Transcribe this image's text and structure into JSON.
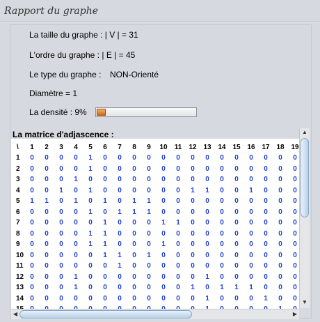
{
  "window": {
    "title": "Rapport du graphe"
  },
  "report": {
    "size_label": "La taille du graphe : | V | = 31",
    "order_label": "L'ordre du graphe : | E | = 45",
    "type_label": "Le type du graphe :",
    "type_value": "NON-Orienté",
    "diameter_label": "Diamètre = 1",
    "density_label": "La densité : 9%",
    "density_fraction": 0.09
  },
  "matrix": {
    "title": "La matrice d'adjascence :",
    "corner": "\\",
    "columns": [
      "1",
      "2",
      "3",
      "4",
      "5",
      "6",
      "7",
      "8",
      "9",
      "10",
      "11",
      "12",
      "13",
      "14",
      "15",
      "16",
      "17",
      "18",
      "19"
    ],
    "rows": [
      {
        "label": "1",
        "values": [
          "0",
          "0",
          "0",
          "0",
          "1",
          "0",
          "0",
          "0",
          "0",
          "0",
          "0",
          "0",
          "0",
          "0",
          "0",
          "0",
          "0",
          "0",
          "0"
        ]
      },
      {
        "label": "2",
        "values": [
          "0",
          "0",
          "0",
          "0",
          "1",
          "0",
          "0",
          "0",
          "0",
          "0",
          "0",
          "0",
          "0",
          "0",
          "0",
          "0",
          "0",
          "0",
          "0"
        ]
      },
      {
        "label": "3",
        "values": [
          "0",
          "0",
          "0",
          "1",
          "0",
          "0",
          "0",
          "0",
          "0",
          "0",
          "0",
          "0",
          "0",
          "0",
          "0",
          "0",
          "0",
          "0",
          "0"
        ]
      },
      {
        "label": "4",
        "values": [
          "0",
          "0",
          "1",
          "0",
          "1",
          "0",
          "0",
          "0",
          "0",
          "0",
          "0",
          "1",
          "1",
          "0",
          "0",
          "1",
          "0",
          "0",
          "0"
        ]
      },
      {
        "label": "5",
        "values": [
          "1",
          "1",
          "0",
          "1",
          "0",
          "1",
          "0",
          "1",
          "1",
          "0",
          "0",
          "0",
          "0",
          "0",
          "0",
          "0",
          "0",
          "0",
          "0"
        ]
      },
      {
        "label": "6",
        "values": [
          "0",
          "0",
          "0",
          "0",
          "1",
          "0",
          "1",
          "1",
          "1",
          "0",
          "0",
          "0",
          "0",
          "0",
          "0",
          "0",
          "0",
          "0",
          "0"
        ]
      },
      {
        "label": "7",
        "values": [
          "0",
          "0",
          "0",
          "0",
          "0",
          "1",
          "0",
          "0",
          "0",
          "1",
          "1",
          "0",
          "0",
          "0",
          "0",
          "0",
          "0",
          "0",
          "0"
        ]
      },
      {
        "label": "8",
        "values": [
          "0",
          "0",
          "0",
          "0",
          "1",
          "1",
          "0",
          "0",
          "0",
          "0",
          "0",
          "0",
          "0",
          "0",
          "0",
          "0",
          "0",
          "0",
          "0"
        ]
      },
      {
        "label": "9",
        "values": [
          "0",
          "0",
          "0",
          "0",
          "1",
          "1",
          "0",
          "0",
          "0",
          "1",
          "0",
          "0",
          "0",
          "0",
          "0",
          "0",
          "0",
          "0",
          "0"
        ]
      },
      {
        "label": "10",
        "values": [
          "0",
          "0",
          "0",
          "0",
          "0",
          "1",
          "1",
          "0",
          "1",
          "0",
          "0",
          "0",
          "0",
          "0",
          "0",
          "0",
          "0",
          "0",
          "0"
        ]
      },
      {
        "label": "11",
        "values": [
          "0",
          "0",
          "0",
          "0",
          "0",
          "0",
          "1",
          "0",
          "0",
          "0",
          "0",
          "0",
          "0",
          "0",
          "0",
          "0",
          "0",
          "0",
          "0"
        ]
      },
      {
        "label": "12",
        "values": [
          "0",
          "0",
          "0",
          "1",
          "0",
          "0",
          "0",
          "0",
          "0",
          "0",
          "0",
          "0",
          "1",
          "0",
          "0",
          "0",
          "0",
          "0",
          "0"
        ]
      },
      {
        "label": "13",
        "values": [
          "0",
          "0",
          "0",
          "1",
          "0",
          "0",
          "0",
          "0",
          "0",
          "0",
          "0",
          "1",
          "0",
          "1",
          "1",
          "1",
          "0",
          "0",
          "0"
        ]
      },
      {
        "label": "14",
        "values": [
          "0",
          "0",
          "0",
          "0",
          "0",
          "0",
          "0",
          "0",
          "0",
          "0",
          "0",
          "0",
          "1",
          "0",
          "0",
          "0",
          "1",
          "0",
          "0"
        ]
      },
      {
        "label": "15",
        "values": [
          "0",
          "0",
          "0",
          "0",
          "0",
          "0",
          "0",
          "0",
          "0",
          "0",
          "0",
          "0",
          "1",
          "0",
          "0",
          "0",
          "0",
          "1",
          "0"
        ]
      }
    ]
  },
  "icons": {
    "scroll_up": "arrow-up-icon",
    "scroll_down": "arrow-down-icon",
    "scroll_left": "arrow-left-icon",
    "scroll_right": "arrow-right-icon"
  }
}
